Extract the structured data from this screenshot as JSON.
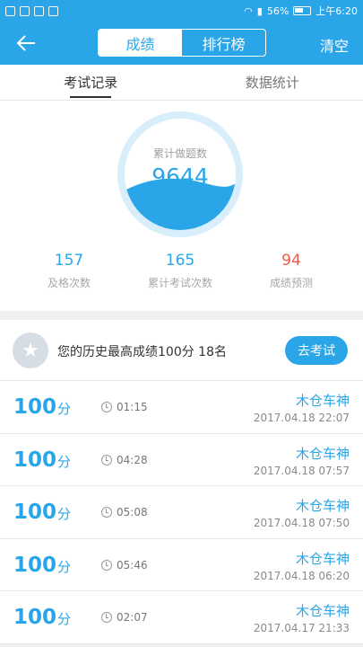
{
  "status": {
    "battery": "56%",
    "time": "上午6:20"
  },
  "nav": {
    "back_icon": "arrow-left-icon",
    "tabs": [
      "成绩",
      "排行榜"
    ],
    "active_tab": 0,
    "clear_label": "清空"
  },
  "subtabs": [
    "考试记录",
    "数据统计"
  ],
  "gauge": {
    "label": "累计做题数",
    "value": "9644",
    "fill_fraction": 0.35
  },
  "metrics": [
    {
      "value": "157",
      "label": "及格次数"
    },
    {
      "value": "165",
      "label": "累计考试次数"
    },
    {
      "value": "94",
      "label": "成绩预测"
    }
  ],
  "best": {
    "text": "您的历史最高成绩100分  18名",
    "button": "去考试"
  },
  "records": [
    {
      "score": "100",
      "unit": "分",
      "duration": "01:15",
      "user": "木仓车神",
      "date": "2017.04.18  22:07"
    },
    {
      "score": "100",
      "unit": "分",
      "duration": "04:28",
      "user": "木仓车神",
      "date": "2017.04.18  07:57"
    },
    {
      "score": "100",
      "unit": "分",
      "duration": "05:08",
      "user": "木仓车神",
      "date": "2017.04.18  07:50"
    },
    {
      "score": "100",
      "unit": "分",
      "duration": "05:46",
      "user": "木仓车神",
      "date": "2017.04.18  06:20"
    },
    {
      "score": "100",
      "unit": "分",
      "duration": "02:07",
      "user": "木仓车神",
      "date": "2017.04.17  21:33"
    }
  ],
  "colors": {
    "accent": "#2aa6e8",
    "red": "#ef5a4b"
  }
}
